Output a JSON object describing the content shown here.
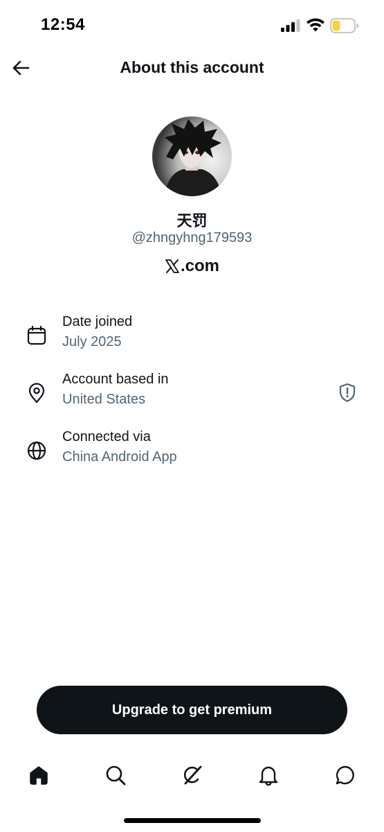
{
  "status_bar": {
    "time": "12:54",
    "signal_icon": "cellular-signal-icon",
    "wifi_icon": "wifi-icon",
    "battery_icon": "battery-low-icon",
    "battery_color": "#f5d33b"
  },
  "header": {
    "title": "About this account",
    "back_icon": "back-arrow-icon"
  },
  "profile": {
    "avatar_icon": "anime-avatar-image",
    "display_name": "天罚",
    "handle": "@zhngyhng179593",
    "site": ".com",
    "site_logo": "x-logo-icon"
  },
  "info": {
    "rows": [
      {
        "icon": "calendar-icon",
        "label": "Date joined",
        "value": "July 2025"
      },
      {
        "icon": "location-pin-icon",
        "label": "Account based in",
        "value": "United States",
        "trailing_icon": "shield-alert-icon"
      },
      {
        "icon": "globe-icon",
        "label": "Connected via",
        "value": "China Android App"
      }
    ]
  },
  "premium_button": {
    "label": "Upgrade to get premium"
  },
  "tab_bar": {
    "tabs": [
      "home-icon",
      "search-icon",
      "grok-icon",
      "notifications-bell-icon",
      "messages-icon"
    ]
  },
  "colors": {
    "text_primary": "#0f1419",
    "text_secondary": "#536471",
    "button_bg": "#0f1419"
  }
}
